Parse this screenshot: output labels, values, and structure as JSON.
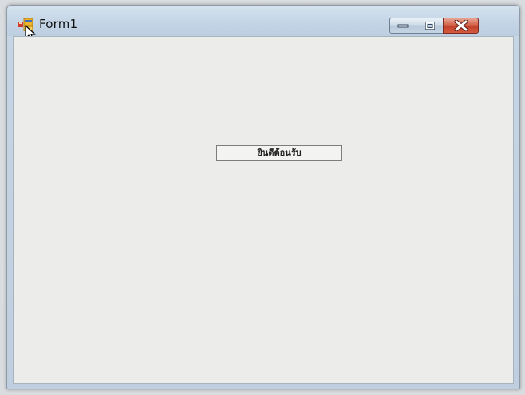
{
  "window": {
    "title": "Form1",
    "icon": "form-app-icon",
    "controls": {
      "minimize_icon": "minimize-icon",
      "maximize_icon": "maximize-icon",
      "close_icon": "close-icon"
    }
  },
  "form": {
    "welcome_label": "ยินดีต้อนรับ"
  },
  "colors": {
    "titlebar": "#c4d5e6",
    "client_background": "#ececea",
    "close_button": "#c2412a"
  }
}
